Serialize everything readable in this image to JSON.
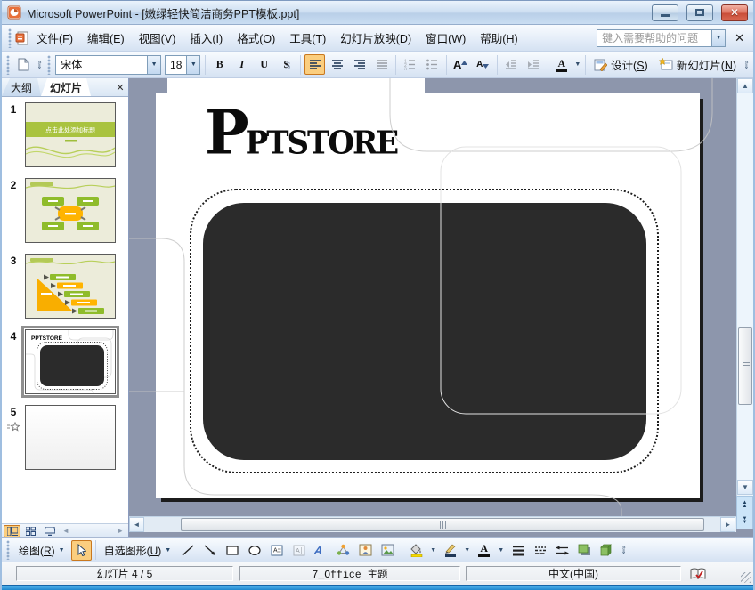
{
  "window": {
    "title": "Microsoft PowerPoint - [嫩绿轻快简洁商务PPT模板.ppt]"
  },
  "menu_bar": {
    "items": [
      {
        "label": "文件(F)"
      },
      {
        "label": "编辑(E)"
      },
      {
        "label": "视图(V)"
      },
      {
        "label": "插入(I)"
      },
      {
        "label": "格式(O)"
      },
      {
        "label": "工具(T)"
      },
      {
        "label": "幻灯片放映(D)"
      },
      {
        "label": "窗口(W)"
      },
      {
        "label": "帮助(H)"
      }
    ],
    "help_search_placeholder": "键入需要帮助的问题"
  },
  "format_toolbar": {
    "font_name": "宋体",
    "font_size": "18",
    "bold": "B",
    "italic": "I",
    "underline": "U",
    "shadow": "S",
    "increase_font": "A",
    "decrease_font": "A",
    "font_color_letter": "A",
    "design_label": "设计(S)",
    "new_slide_label": "新幻灯片(N)"
  },
  "slides_panel": {
    "tabs": [
      {
        "label": "大纲",
        "active": false
      },
      {
        "label": "幻灯片",
        "active": true
      }
    ],
    "slides": [
      {
        "number": "1"
      },
      {
        "number": "2"
      },
      {
        "number": "3"
      },
      {
        "number": "4"
      },
      {
        "number": "5"
      }
    ],
    "selected_slide": 4,
    "slide1_title_placeholder": "点击此处添加标题"
  },
  "canvas": {
    "logo_text": "PPTSTORE"
  },
  "drawing_toolbar": {
    "draw_label": "绘图(R)",
    "autoshapes_label": "自选图形(U)",
    "font_color_letter": "A"
  },
  "status_bar": {
    "slide_indicator": "幻灯片 4 / 5",
    "theme_name": "7_Office 主题",
    "language": "中文(中国)"
  },
  "icons": {
    "dropdown": "▼",
    "close": "✕",
    "up": "▲",
    "down": "▼",
    "left": "◄",
    "right": "►",
    "chev_top": "»",
    "chev_bottom": "⇓"
  },
  "colors": {
    "workspace_background": "#8D96AC",
    "template_green": "#A9C33F",
    "template_orange": "#F9AE00",
    "dark_shape": "#2B2B2B",
    "selection_highlight": "#FBCE7F",
    "close_button_red": "#D96852"
  }
}
